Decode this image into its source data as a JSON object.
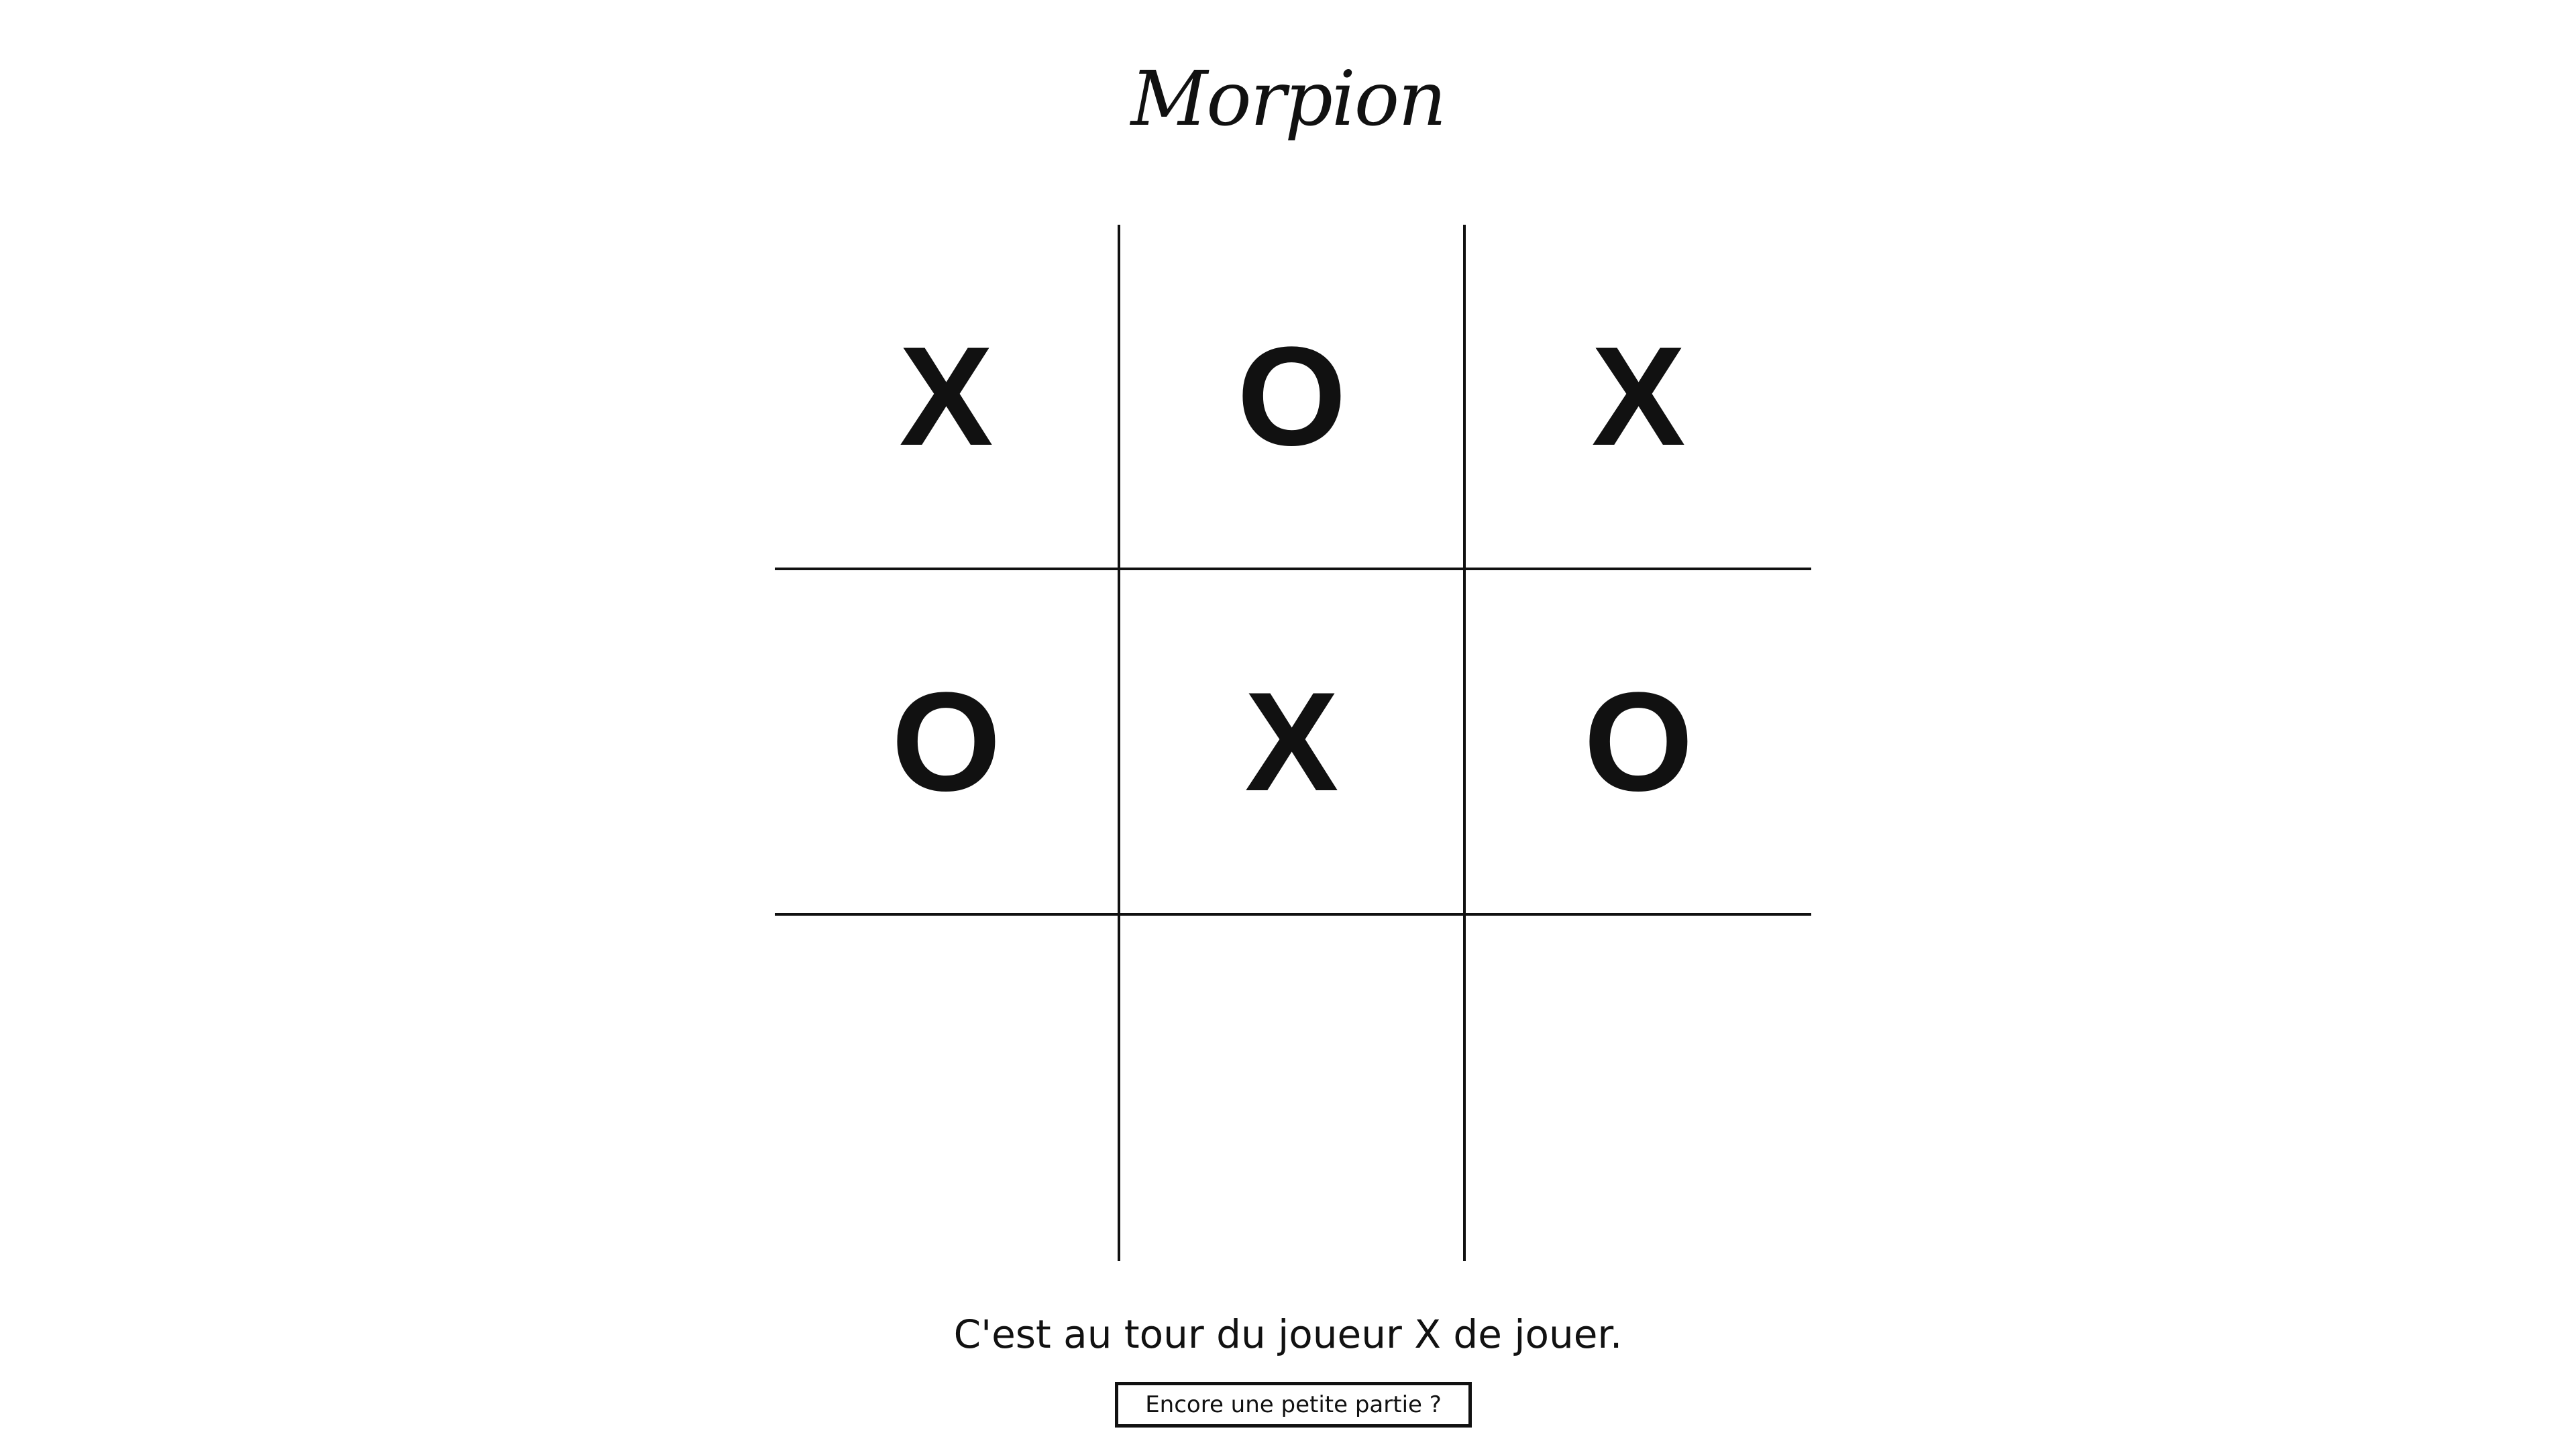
{
  "game": {
    "title": "Morpion",
    "board": [
      [
        "X",
        "O",
        "X"
      ],
      [
        "O",
        "X",
        "O"
      ],
      [
        "",
        "",
        ""
      ]
    ],
    "status": "C'est au tour du joueur X de jouer.",
    "restart_label": "Encore une petite partie ?"
  }
}
